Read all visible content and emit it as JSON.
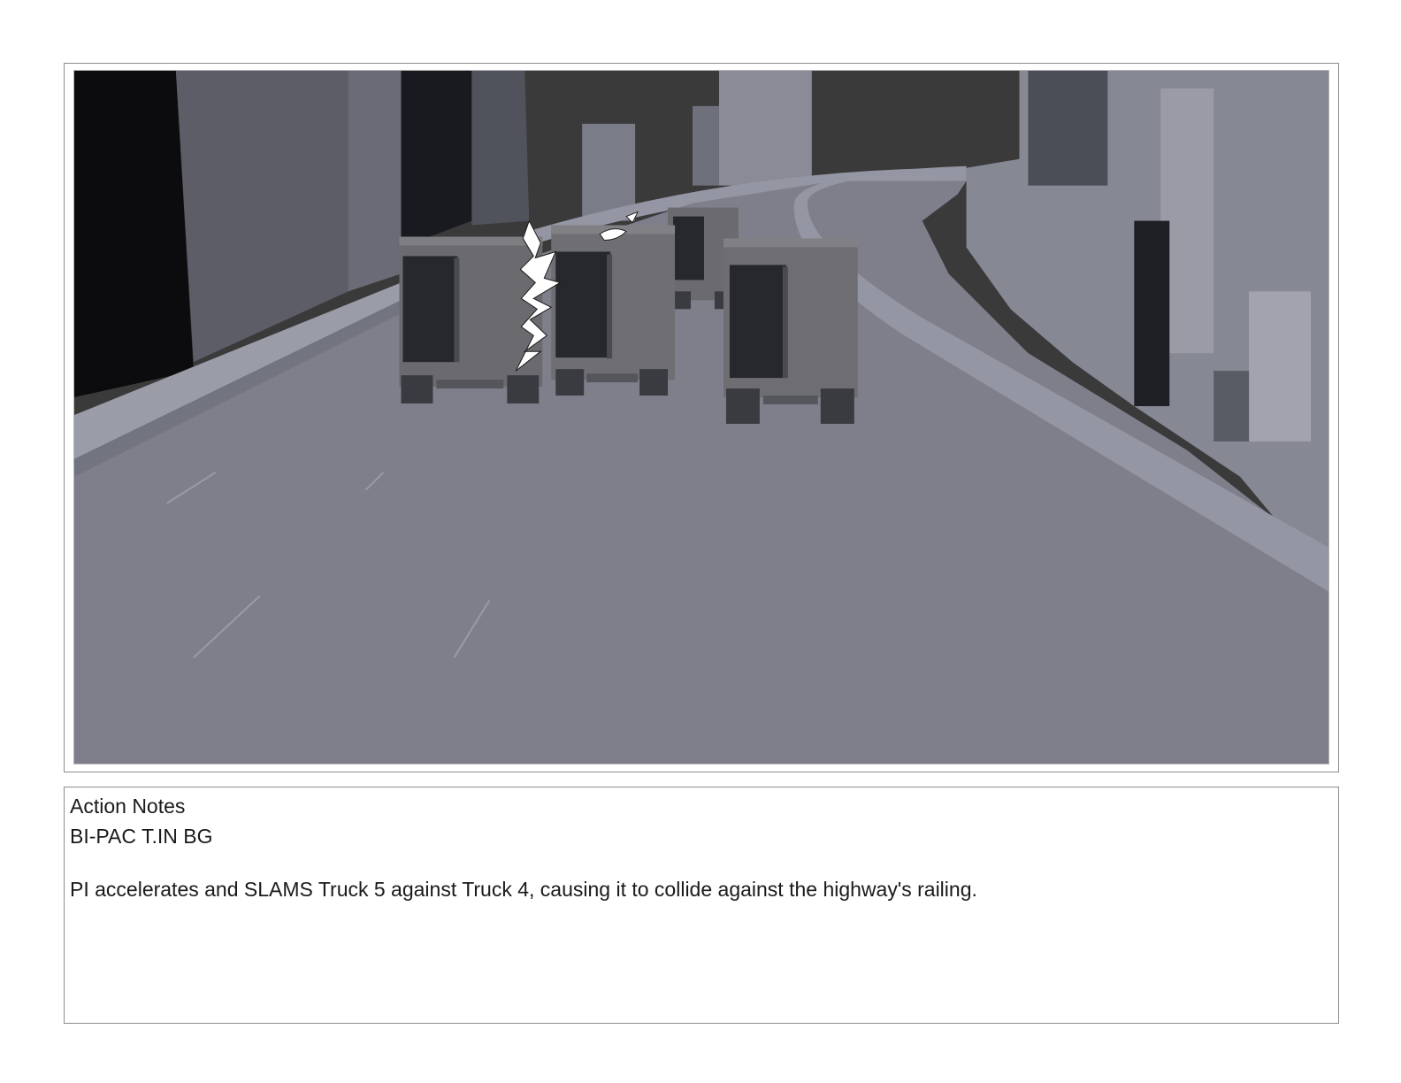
{
  "storyboard_panel": {
    "image_alt": "3D previs frame: trucks on an elevated city highway, one truck slammed against another with a white impact burst"
  },
  "notes": {
    "heading": "Action Notes",
    "shot_code": "BI-PAC T.IN BG",
    "description": "PI accelerates and SLAMS Truck 5 against Truck 4, causing it to collide against the highway's railing."
  },
  "colors": {
    "sky": "#3a3a3b",
    "road": "#7e7f8b",
    "building_light": "#8f909c",
    "building_dark": "#1c1c20",
    "truck_body": "#6b6b6f",
    "truck_door": "#26282e",
    "railing": "#8a8c98",
    "impact": "#ffffff"
  }
}
